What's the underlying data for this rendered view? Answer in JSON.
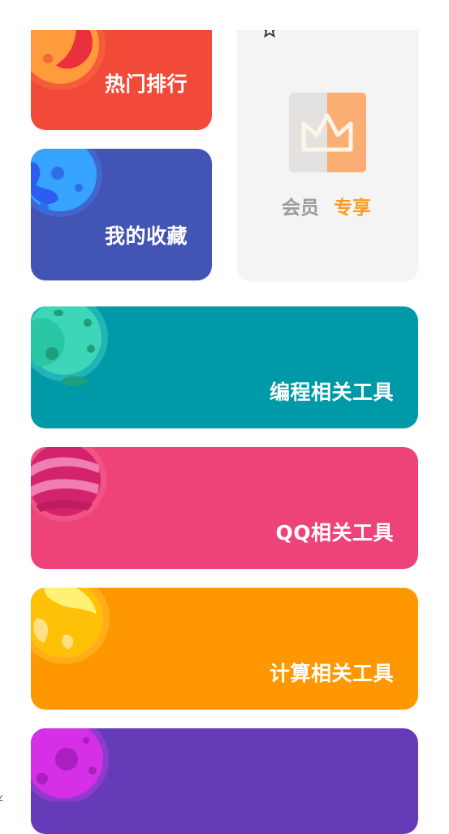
{
  "cards": {
    "hot": {
      "label": "热门排行",
      "color": "#f24a38",
      "icon": "orange-planet-icon"
    },
    "favorites": {
      "label": "我的收藏",
      "color": "#4254b4",
      "icon": "blue-planet-icon"
    },
    "vip": {
      "label_main": "会员",
      "label_accent": "专享",
      "color": "#f4f4f4",
      "accent_color": "#ff9a1a",
      "icons": [
        "star-icon",
        "crown-icon"
      ]
    },
    "coding": {
      "label": "编程相关工具",
      "color": "#0099a7",
      "icon": "teal-planet-icon"
    },
    "qq": {
      "label": "QQ相关工具",
      "color": "#ee4379",
      "icon": "pink-planet-icon"
    },
    "calc": {
      "label": "计算相关工具",
      "color": "#ff9800",
      "icon": "sun-planet-icon"
    },
    "more": {
      "label": "",
      "color": "#673ab7",
      "icon": "magenta-planet-icon"
    }
  }
}
